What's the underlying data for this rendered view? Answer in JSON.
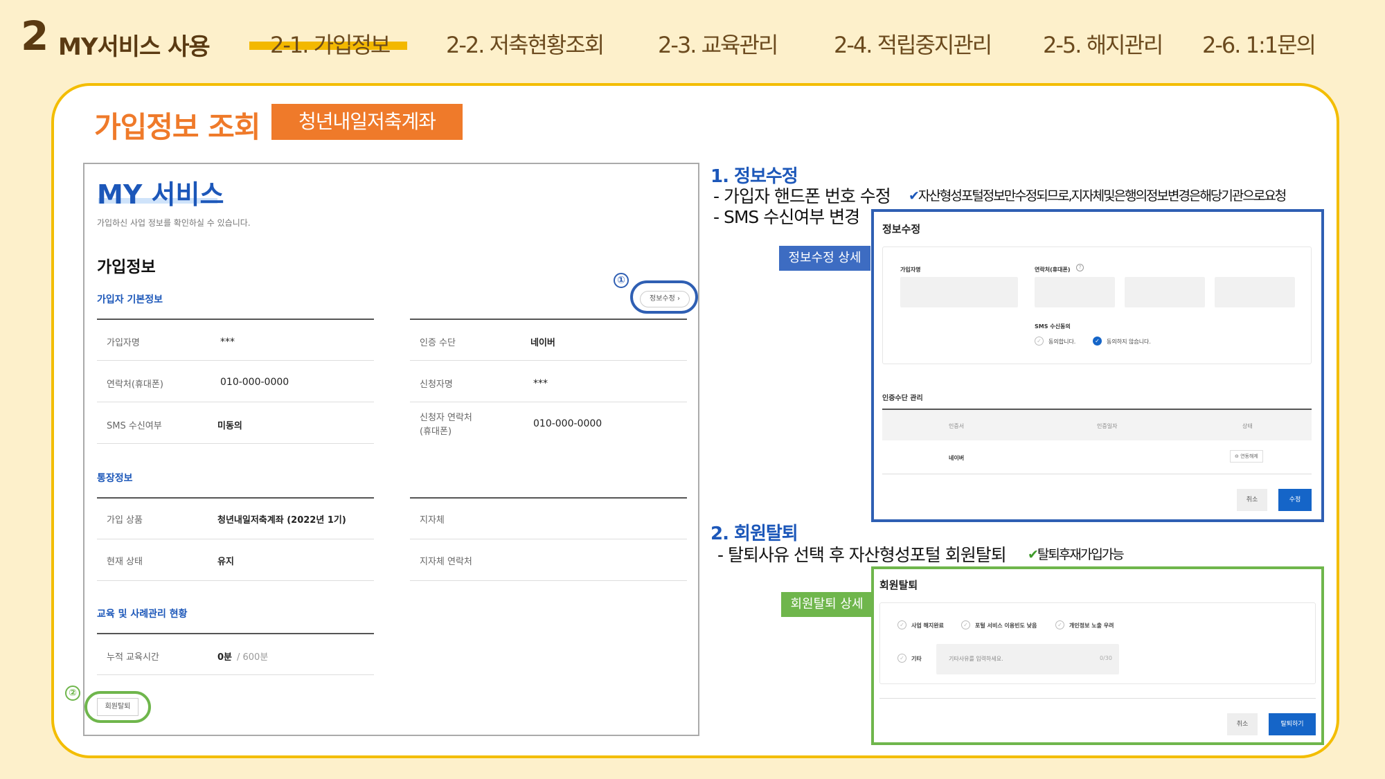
{
  "header": {
    "section_number": "2",
    "section_title": "MY서비스 사용",
    "tabs": [
      {
        "label": "2-1. 가입정보",
        "active": true
      },
      {
        "label": "2-2. 저축현황조회",
        "active": false
      },
      {
        "label": "2-3. 교육관리",
        "active": false
      },
      {
        "label": "2-4. 적립중지관리",
        "active": false
      },
      {
        "label": "2-5. 해지관리",
        "active": false
      },
      {
        "label": "2-6. 1:1문의",
        "active": false
      }
    ]
  },
  "page": {
    "title": "가입정보 조회",
    "tag": "청년내일저축계좌"
  },
  "screenshot": {
    "my_title": "MY 서비스",
    "my_desc": "가입하신 사업 정보를 확인하실 수 있습니다.",
    "info_heading": "가입정보",
    "basic_heading": "가입자 기본정보",
    "edit_button": "정보수정 ›",
    "marker_1": "①",
    "marker_2": "②",
    "basic_left": [
      {
        "label": "가입자명",
        "value": "***"
      },
      {
        "label": "연락처(휴대폰)",
        "value": "010-000-0000"
      },
      {
        "label": "SMS 수신여부",
        "value": "미동의"
      }
    ],
    "basic_right": [
      {
        "label": "인증 수단",
        "value": "네이버"
      },
      {
        "label": "신청자명",
        "value": "***"
      },
      {
        "label": "신청자 연락처",
        "label2": "(휴대폰)",
        "value": "010-000-0000"
      }
    ],
    "account_heading": "통장정보",
    "account_left": [
      {
        "label": "가입 상품",
        "value": "청년내일저축계좌 (2022년 1기)"
      },
      {
        "label": "현재 상태",
        "value": "유지"
      }
    ],
    "account_right": [
      {
        "label": "지자체",
        "value": ""
      },
      {
        "label": "지자체 연락처",
        "value": ""
      }
    ],
    "edu_heading": "교육 및 사례관리 현황",
    "edu_row": {
      "label": "누적 교육시간",
      "value": "0분",
      "total": "/ 600분"
    },
    "withdraw_button": "회원탈퇴"
  },
  "notes": {
    "n1_head": "1.  정보수정",
    "n1_line1": "- 가입자 핸드폰 번호 수정",
    "n1_check": "✔",
    "n1_note": "자산형성포털정보만수정되므로,지자체및은행의정보변경은해당기관으로요청",
    "n1_line2": "- SMS 수신여부 변경",
    "n1_tag": "정보수정 상세",
    "n2_head": "2.  회원탈퇴",
    "n2_line1": "- 탈퇴사유 선택 후 자산형성포털 회원탈퇴",
    "n2_check": "✔",
    "n2_note": "탈퇴후재가입가능",
    "n2_tag": "회원탈퇴 상세"
  },
  "edit_detail": {
    "title": "정보수정",
    "name_label": "가입자명",
    "phone_label": "연락처(휴대폰)",
    "help_icon": "?",
    "sms_label": "SMS 수신동의",
    "agree": "동의합니다.",
    "disagree": "동의하지 않습니다.",
    "auth_title": "인증수단 관리",
    "auth_cols": [
      "인증서",
      "인증일자",
      "상태"
    ],
    "auth_row": {
      "name": "네이버",
      "status": "⊖ 연동해제"
    },
    "cancel": "취소",
    "submit": "수정"
  },
  "withdraw_detail": {
    "title": "회원탈퇴",
    "reasons": [
      "사업 해지완료",
      "포털 서비스 이용빈도 낮음",
      "개인정보 노출 우려"
    ],
    "other_label": "기타",
    "other_placeholder": "기타사유를 입력하세요.",
    "counter": "0/30",
    "cancel": "취소",
    "submit": "탈퇴하기"
  },
  "colors": {
    "accent_orange": "#ef7a2a",
    "accent_yellow": "#f3bd00",
    "brand_blue": "#1c57b9",
    "highlight_green": "#6fb64c",
    "background": "#fdf0cb"
  }
}
